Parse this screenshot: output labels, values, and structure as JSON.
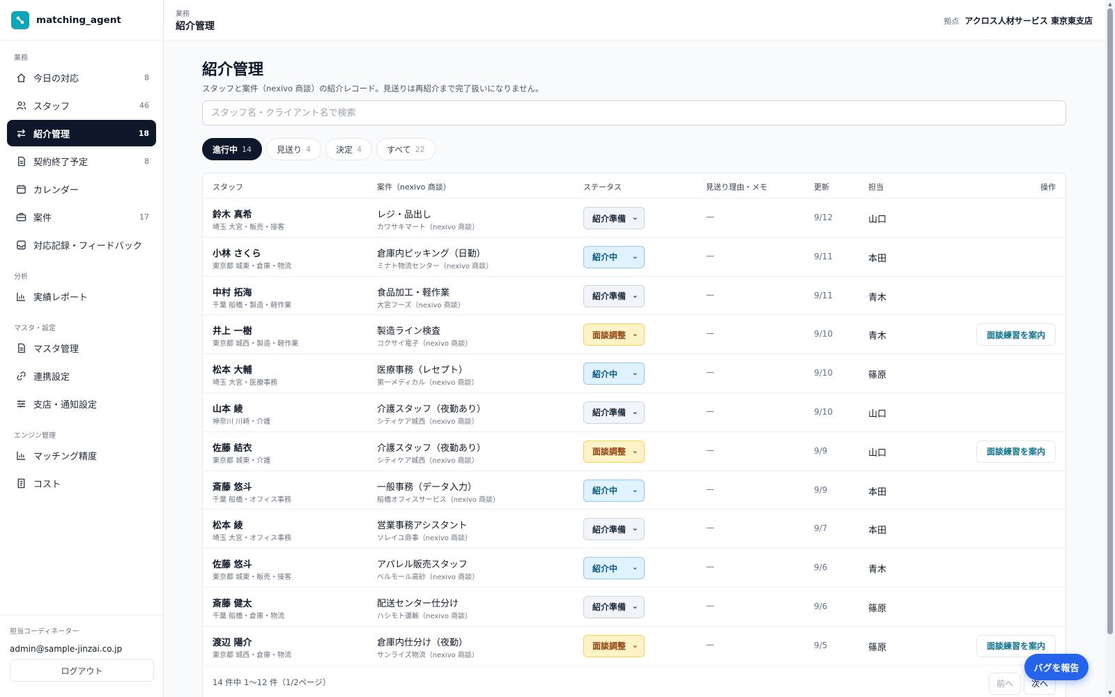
{
  "app": {
    "name": "matching_agent"
  },
  "sidebar": {
    "sections": [
      "業務",
      "分析",
      "マスタ・設定",
      "エンジン管理"
    ],
    "items": [
      {
        "label": "今日の対応",
        "count": "8",
        "icon": "home-icon"
      },
      {
        "label": "スタッフ",
        "count": "46",
        "icon": "users-icon"
      },
      {
        "label": "紹介管理",
        "count": "18",
        "icon": "arrows-swap-icon"
      },
      {
        "label": "契約終了予定",
        "count": "8",
        "icon": "document-icon"
      },
      {
        "label": "カレンダー",
        "count": "",
        "icon": "calendar-icon"
      },
      {
        "label": "案件",
        "count": "17",
        "icon": "briefcase-icon"
      },
      {
        "label": "対応記録・フィードバック",
        "count": "",
        "icon": "inbox-icon"
      },
      {
        "label": "実績レポート",
        "count": "",
        "icon": "bar-chart-icon"
      },
      {
        "label": "マスタ管理",
        "count": "",
        "icon": "document-icon"
      },
      {
        "label": "連携設定",
        "count": "",
        "icon": "link-icon"
      },
      {
        "label": "支店・通知設定",
        "count": "",
        "icon": "sliders-icon"
      },
      {
        "label": "マッチング精度",
        "count": "",
        "icon": "bar-chart-icon"
      },
      {
        "label": "コスト",
        "count": "",
        "icon": "receipt-icon"
      }
    ],
    "active_index": 2,
    "footer": {
      "label": "担当コーディネーター",
      "email": "admin@sample-jinzai.co.jp",
      "logout": "ログアウト"
    }
  },
  "header": {
    "crumb": "業務",
    "title": "紹介管理",
    "branch_label": "拠点",
    "branch_name": "アクロス人材サービス 東京東支店"
  },
  "main": {
    "title": "紹介管理",
    "description": "スタッフと案件（nexivo 商談）の紹介レコード。見送りは再紹介まで完了扱いになりません。",
    "search_placeholder": "スタッフ名・クライアント名で検索",
    "tabs": [
      {
        "label": "進行中",
        "count": "14"
      },
      {
        "label": "見送り",
        "count": "4"
      },
      {
        "label": "決定",
        "count": "4"
      },
      {
        "label": "すべて",
        "count": "22"
      }
    ],
    "columns": {
      "staff": "スタッフ",
      "job": "案件（nexivo 商談）",
      "status": "ステータス",
      "memo": "見送り理由・メモ",
      "updated": "更新",
      "owner": "担当",
      "action": "操作"
    },
    "rows": [
      {
        "name": "鈴木 真希",
        "area": "埼玉 大宮・販売・接客",
        "job": "レジ・品出し",
        "client": "カワサキマート（nexivo 商談）",
        "status": "紹介準備",
        "memo": "—",
        "updated": "9/12",
        "owner": "山口",
        "action": ""
      },
      {
        "name": "小林 さくら",
        "area": "東京都 城東・倉庫・物流",
        "job": "倉庫内ピッキング（日勤）",
        "client": "ミナト物流センター（nexivo 商談）",
        "status": "紹介中",
        "memo": "—",
        "updated": "9/11",
        "owner": "本田",
        "action": ""
      },
      {
        "name": "中村 拓海",
        "area": "千葉 船橋・製造・軽作業",
        "job": "食品加工・軽作業",
        "client": "大宮フーズ（nexivo 商談）",
        "status": "紹介準備",
        "memo": "—",
        "updated": "9/11",
        "owner": "青木",
        "action": ""
      },
      {
        "name": "井上 一樹",
        "area": "東京都 城西・製造・軽作業",
        "job": "製造ライン検査",
        "client": "コクサイ電子（nexivo 商談）",
        "status": "面談調整",
        "memo": "—",
        "updated": "9/10",
        "owner": "青木",
        "action": "面談練習を案内"
      },
      {
        "name": "松本 大輔",
        "area": "埼玉 大宮・医療事務",
        "job": "医療事務（レセプト）",
        "client": "第一メディカル（nexivo 商談）",
        "status": "紹介中",
        "memo": "—",
        "updated": "9/10",
        "owner": "篠原",
        "action": ""
      },
      {
        "name": "山本 綾",
        "area": "神奈川 川崎・介護",
        "job": "介護スタッフ（夜勤あり）",
        "client": "シティケア城西（nexivo 商談）",
        "status": "紹介準備",
        "memo": "—",
        "updated": "9/10",
        "owner": "山口",
        "action": ""
      },
      {
        "name": "佐藤 結衣",
        "area": "東京都 城東・介護",
        "job": "介護スタッフ（夜勤あり）",
        "client": "シティケア城西（nexivo 商談）",
        "status": "面談調整",
        "memo": "—",
        "updated": "9/9",
        "owner": "山口",
        "action": "面談練習を案内"
      },
      {
        "name": "斎藤 悠斗",
        "area": "千葉 船橋・オフィス事務",
        "job": "一般事務（データ入力）",
        "client": "船橋オフィスサービス（nexivo 商談）",
        "status": "紹介中",
        "memo": "—",
        "updated": "9/9",
        "owner": "本田",
        "action": ""
      },
      {
        "name": "松本 綾",
        "area": "埼玉 大宮・オフィス事務",
        "job": "営業事務アシスタント",
        "client": "ソレイユ商事（nexivo 商談）",
        "status": "紹介準備",
        "memo": "—",
        "updated": "9/7",
        "owner": "本田",
        "action": ""
      },
      {
        "name": "佐藤 悠斗",
        "area": "東京都 城東・販売・接客",
        "job": "アパレル販売スタッフ",
        "client": "ベルモール高砂（nexivo 商談）",
        "status": "紹介中",
        "memo": "—",
        "updated": "9/6",
        "owner": "青木",
        "action": ""
      },
      {
        "name": "斎藤 健太",
        "area": "千葉 船橋・倉庫・物流",
        "job": "配送センター仕分け",
        "client": "ハシモト運輸（nexivo 商談）",
        "status": "紹介準備",
        "memo": "—",
        "updated": "9/6",
        "owner": "篠原",
        "action": ""
      },
      {
        "name": "渡辺 陽介",
        "area": "東京都 城西・倉庫・物流",
        "job": "倉庫内仕分け（夜勤）",
        "client": "サンライズ物流（nexivo 商談）",
        "status": "面談調整",
        "memo": "—",
        "updated": "9/5",
        "owner": "篠原",
        "action": "面談練習を案内"
      }
    ],
    "pagination": {
      "info": "14 件中 1〜12 件（1/2ページ）",
      "prev": "前へ",
      "next": "次へ"
    }
  },
  "report_button": "バグを報告",
  "status_colors": {
    "紹介準備": "#f1f5f9",
    "紹介中": "#e0f2fe",
    "面談調整": "#fef3c7"
  },
  "accent": "#0f172a"
}
